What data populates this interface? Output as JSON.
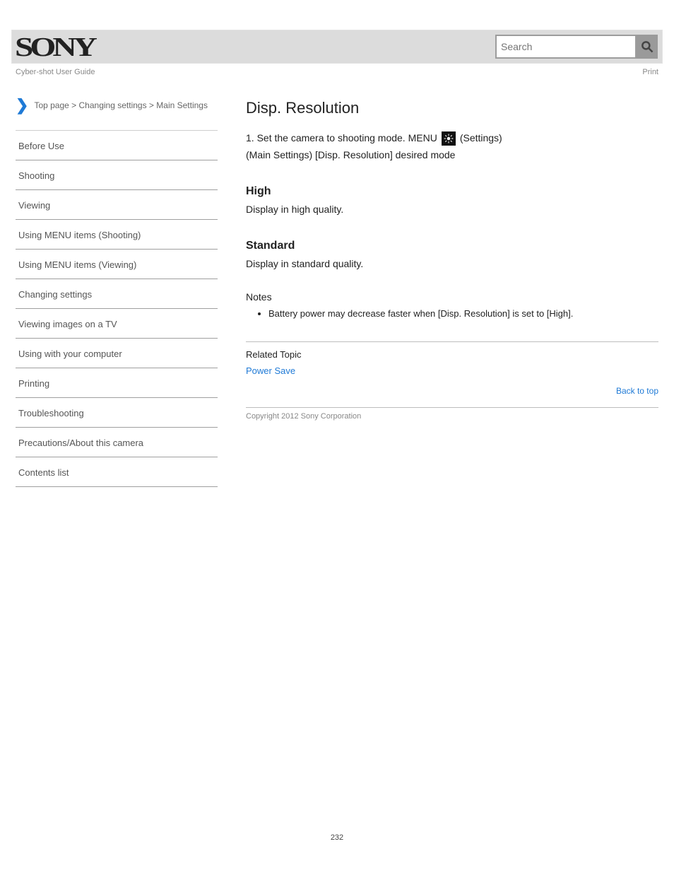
{
  "brand": "SONY",
  "header": {
    "left": "Cyber-shot User Guide",
    "right": "Print",
    "search_placeholder": "Search"
  },
  "breadcrumb": {
    "top": "Top page",
    "cat": "Changing settings",
    "sub": "Main Settings"
  },
  "nav": {
    "items": [
      "Before Use",
      "Shooting",
      "Viewing",
      "Using MENU items (Shooting)",
      "Using MENU items (Viewing)",
      "Changing settings",
      "Viewing images on a TV",
      "Using with your computer",
      "Printing",
      "Troubleshooting",
      "Precautions/About this camera",
      "Contents list"
    ]
  },
  "article": {
    "title": "Disp. Resolution",
    "lead_pre": "1.  Set the camera to shooting mode.  MENU ",
    "lead_mid": " (Settings) ",
    "lead_post": " (Main Settings)  [Disp. Resolution]  desired mode ",
    "sub_high": "High",
    "sub_high_body": "Display in high quality.",
    "sub_std": "Standard",
    "sub_std_body": "Display in standard quality.",
    "note_label": "Notes",
    "note_item": "Battery power may decrease faster when [Disp. Resolution] is set to [High].",
    "related_label": "Related Topic",
    "related_link": "Power Save",
    "back_to_top": "Back to top",
    "copyright": "Copyright 2012 Sony Corporation"
  },
  "page_number": "232"
}
